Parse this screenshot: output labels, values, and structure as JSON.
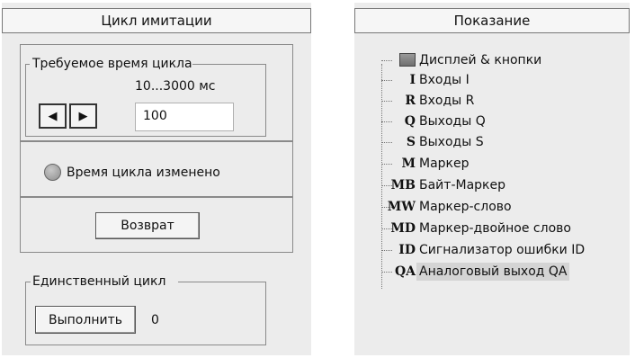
{
  "cycle_panel": {
    "title": "Цикл имитации",
    "required_cycle_time": {
      "legend": "Требуемое время цикла",
      "range_label": "10...3000 мс",
      "value": "100",
      "decrease_glyph": "◀",
      "increase_glyph": "▶"
    },
    "cycle_changed_label": "Время цикла изменено",
    "reset_button_label": "Возврат",
    "single_cycle": {
      "legend": "Единственный цикл",
      "execute_button_label": "Выполнить",
      "counter": "0"
    }
  },
  "display_panel": {
    "title": "Показание",
    "tree_items": [
      {
        "icon": "display-and-buttons-icon",
        "code": "",
        "label": "Дисплей & кнопки"
      },
      {
        "icon": "inputs-i-icon",
        "code": "I",
        "label": "Входы I"
      },
      {
        "icon": "inputs-r-icon",
        "code": "R",
        "label": "Входы R"
      },
      {
        "icon": "outputs-q-icon",
        "code": "Q",
        "label": "Выходы Q"
      },
      {
        "icon": "outputs-s-icon",
        "code": "S",
        "label": "Выходы S"
      },
      {
        "icon": "marker-icon",
        "code": "M",
        "label": "Маркер"
      },
      {
        "icon": "byte-marker-icon",
        "code": "MB",
        "label": "Байт-Маркер"
      },
      {
        "icon": "marker-word-icon",
        "code": "MW",
        "label": "Маркер-слово"
      },
      {
        "icon": "marker-dword-icon",
        "code": "MD",
        "label": "Маркер-двойное слово"
      },
      {
        "icon": "error-id-icon",
        "code": "ID",
        "label": "Сигнализатор ошибки ID"
      },
      {
        "icon": "analog-output-qa-icon",
        "code": "QA",
        "label": "Аналоговый выход QA"
      }
    ],
    "selected_index": 10
  }
}
